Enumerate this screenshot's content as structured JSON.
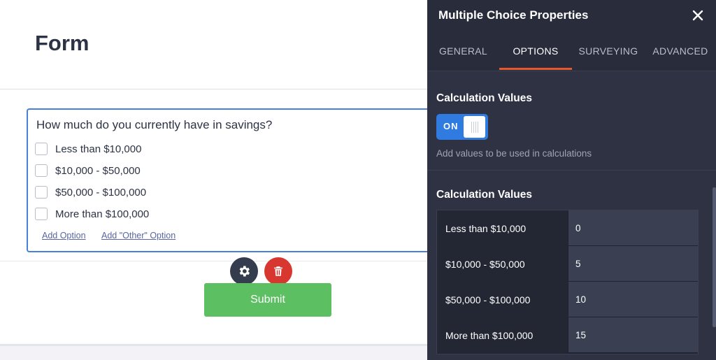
{
  "form": {
    "title": "Form",
    "question": {
      "label": "How much do you currently have in savings?",
      "options": [
        "Less than $10,000",
        "$10,000 - $50,000",
        "$50,000 - $100,000",
        "More than $100,000"
      ],
      "add_option": "Add Option",
      "add_other_option": "Add \"Other\" Option"
    },
    "submit_label": "Submit"
  },
  "panel": {
    "title": "Multiple Choice Properties",
    "tabs": [
      "GENERAL",
      "OPTIONS",
      "SURVEYING",
      "ADVANCED"
    ],
    "active_tab": "OPTIONS",
    "calc_toggle": {
      "heading": "Calculation Values",
      "state": "ON",
      "description": "Add values to be used in calculations"
    },
    "calc_table": {
      "heading": "Calculation Values",
      "rows": [
        {
          "label": "Less than $10,000",
          "value": "0"
        },
        {
          "label": "$10,000 - $50,000",
          "value": "5"
        },
        {
          "label": "$50,000 - $100,000",
          "value": "10"
        },
        {
          "label": "More than $100,000",
          "value": "15"
        }
      ]
    }
  },
  "colors": {
    "accent_blue": "#2f7be0",
    "tab_underline": "#e7582c",
    "submit_green": "#5cbf62",
    "delete_red": "#d7372f",
    "panel_bg": "#2e3242"
  },
  "icons": [
    "gear-icon",
    "trash-icon",
    "close-icon"
  ]
}
